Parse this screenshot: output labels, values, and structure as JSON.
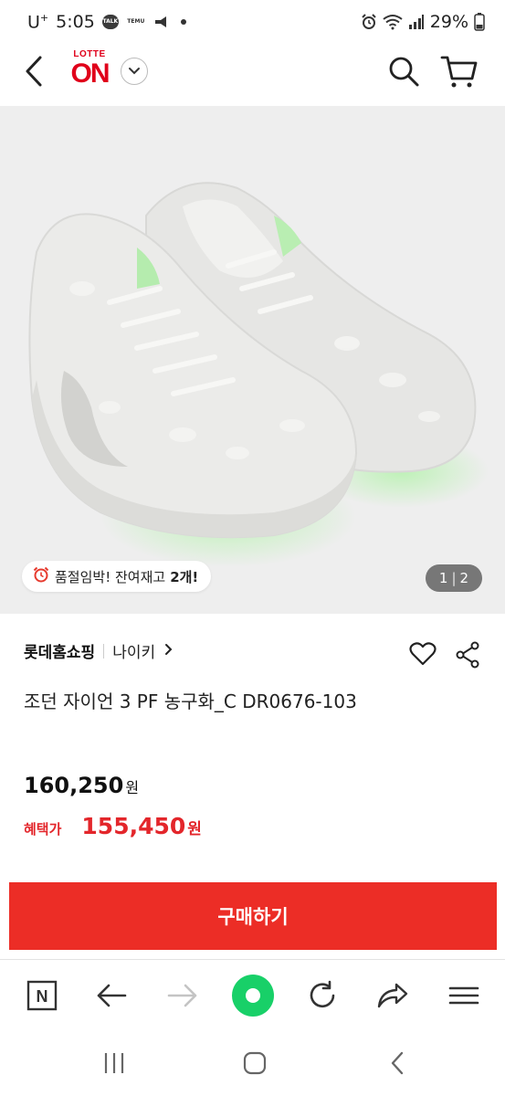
{
  "status_bar": {
    "carrier": "U",
    "carrier_sup": "+",
    "time": "5:05",
    "talk_label": "TALK",
    "temu_label": "TEMU",
    "battery": "29%"
  },
  "header": {
    "logo_top": "LOTTE",
    "logo_main": "ON"
  },
  "gallery": {
    "stock_text": "품절임박! 잔여재고",
    "stock_count": "2개!",
    "current_page": "1",
    "total_pages": "2"
  },
  "product": {
    "seller": "롯데홈쇼핑",
    "brand": "나이키",
    "title": "조던 자이언 3 PF 농구화_C DR0676-103",
    "price": "160,250",
    "price_unit": "원",
    "benefit_label": "혜택가",
    "benefit_price": "155,450",
    "benefit_unit": "원"
  },
  "buy_button": {
    "label": "구매하기"
  },
  "toolbar": {
    "n_label": "N"
  },
  "colors": {
    "brand_red": "#e0001a",
    "buy_red": "#ec2d26",
    "benefit_red": "#e3262b",
    "home_green": "#18d068"
  },
  "icons": [
    "back-icon",
    "chevron-down-icon",
    "search-icon",
    "cart-icon",
    "alarm-clock-icon",
    "heart-icon",
    "share-icon",
    "arrow-left-icon",
    "arrow-right-icon",
    "reload-icon",
    "share-arrow-icon",
    "menu-icon",
    "recent-apps-icon",
    "home-icon"
  ]
}
